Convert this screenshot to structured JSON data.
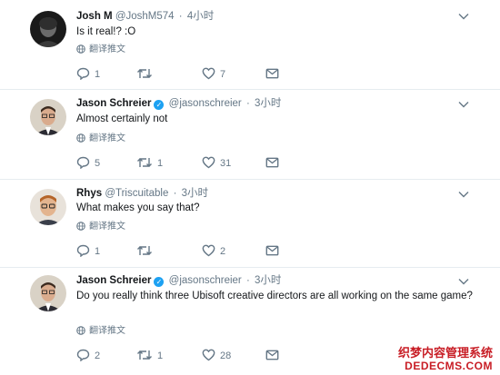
{
  "tweets": [
    {
      "name": "Josh M",
      "handle": "@JoshM574",
      "time": "4小时",
      "verified": false,
      "text": "Is it real!? :O",
      "translate": "翻译推文",
      "actions": {
        "reply": "1",
        "retweet": "",
        "like": "7"
      }
    },
    {
      "name": "Jason Schreier",
      "handle": "@jasonschreier",
      "time": "3小时",
      "verified": true,
      "text": "Almost certainly not",
      "translate": "翻译推文",
      "actions": {
        "reply": "5",
        "retweet": "1",
        "like": "31"
      }
    },
    {
      "name": "Rhys",
      "handle": "@Triscuitable",
      "time": "3小时",
      "verified": false,
      "text": "What makes you say that?",
      "translate": "翻译推文",
      "actions": {
        "reply": "1",
        "retweet": "",
        "like": "2"
      }
    },
    {
      "name": "Jason Schreier",
      "handle": "@jasonschreier",
      "time": "3小时",
      "verified": true,
      "text": "Do you really think three Ubisoft creative directors are all working on the same game?",
      "translate": "翻译推文",
      "actions": {
        "reply": "2",
        "retweet": "1",
        "like": "28"
      }
    }
  ],
  "separator": "·",
  "watermark": {
    "line1": "织梦内容管理系统",
    "line2": "DEDECMS.COM"
  },
  "colors": {
    "accent": "#1da1f2",
    "muted": "#657786",
    "text": "#14171a",
    "border": "#e6ecf0",
    "watermark": "#c81d25"
  }
}
